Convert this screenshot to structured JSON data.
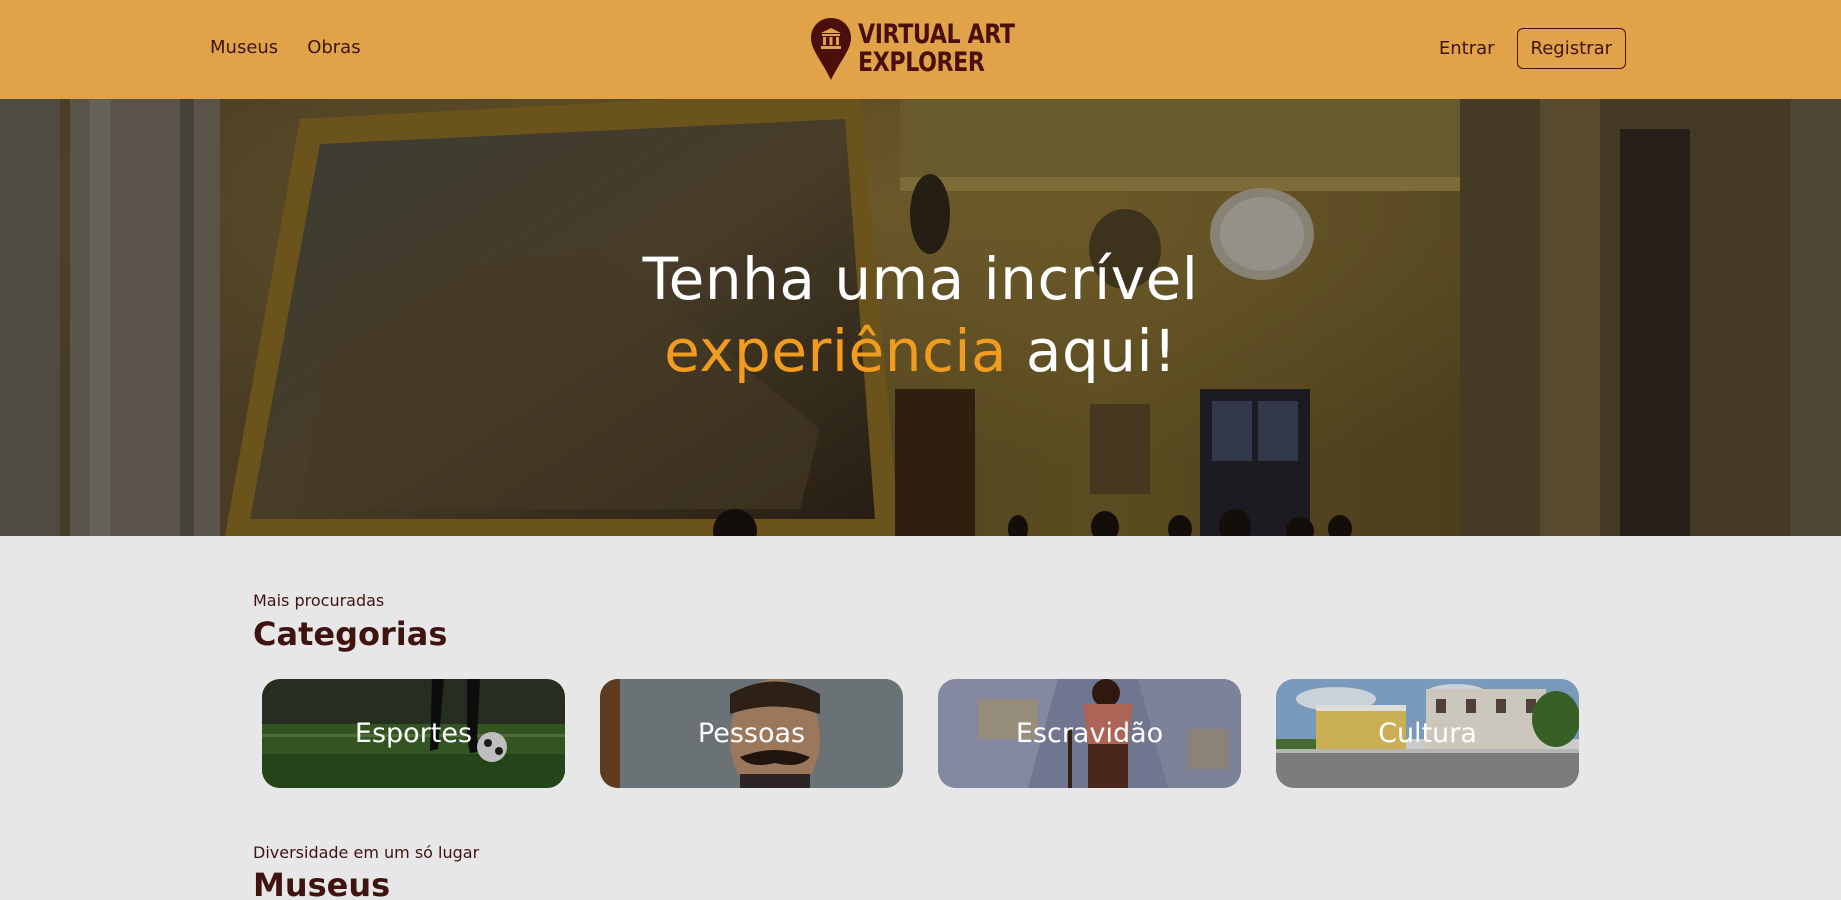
{
  "header": {
    "nav": [
      {
        "label": "Museus"
      },
      {
        "label": "Obras"
      }
    ],
    "logo": {
      "line1": "VIRTUAL ART",
      "line2": "EXPLORER"
    },
    "login_label": "Entrar",
    "register_label": "Registrar"
  },
  "hero": {
    "title_line1": "Tenha uma incrível",
    "title_accent": "experiência",
    "title_rest": " aqui!"
  },
  "categories_section": {
    "eyebrow": "Mais procuradas",
    "title": "Categorias",
    "items": [
      {
        "label": "Esportes"
      },
      {
        "label": "Pessoas"
      },
      {
        "label": "Escravidão"
      },
      {
        "label": "Cultura"
      }
    ]
  },
  "museums_section": {
    "eyebrow": "Diversidade em um só lugar",
    "title": "Museus"
  },
  "colors": {
    "header_bg": "#e0a34a",
    "brand_dark": "#3f1410",
    "accent": "#f29c1f",
    "page_bg": "#e8e7e7"
  }
}
